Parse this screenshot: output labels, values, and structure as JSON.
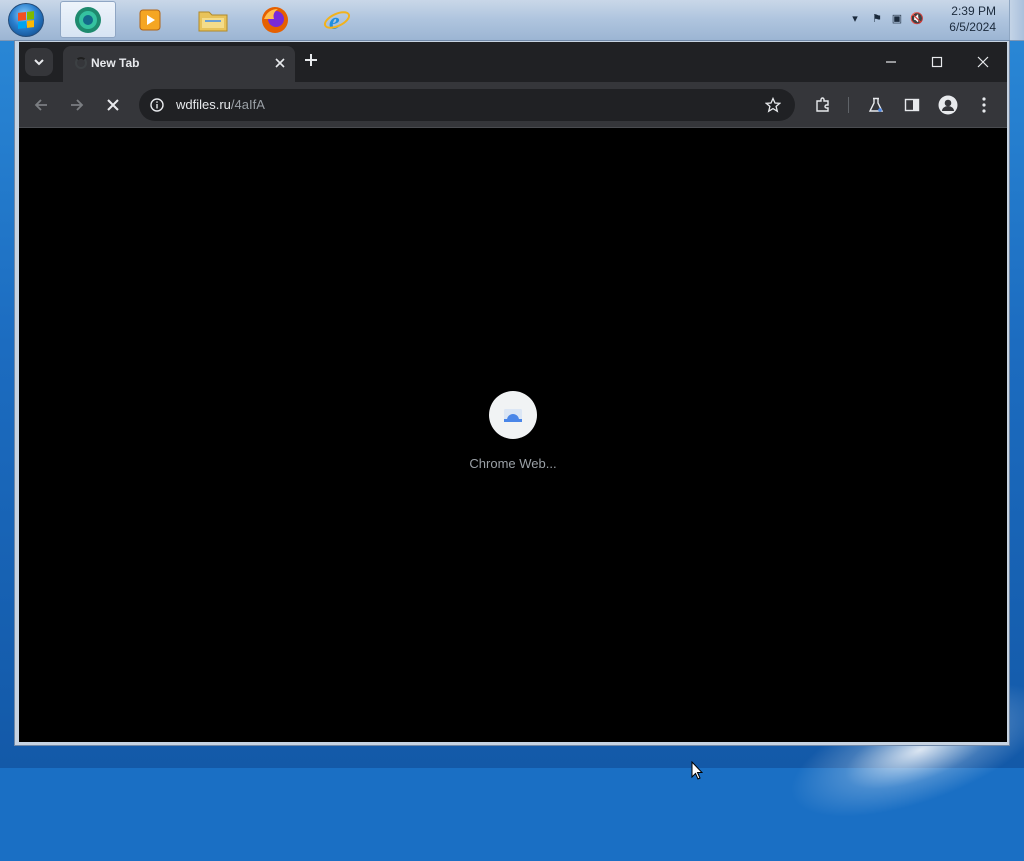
{
  "taskbar": {
    "clock": {
      "time": "2:39 PM",
      "date": "6/5/2024"
    },
    "pinned": [
      "start-button",
      "chrome",
      "media-player",
      "file-explorer",
      "firefox",
      "internet-explorer"
    ]
  },
  "browser": {
    "tab": {
      "title": "New Tab"
    },
    "address": {
      "host": "wdfiles.ru",
      "path": "/4aIfA"
    },
    "content": {
      "loading_label": "Chrome Web..."
    }
  },
  "colors": {
    "chrome_dark": "#202124",
    "toolbar": "#35363a",
    "page_bg": "#000000",
    "accent_blue": "#4a86e8"
  }
}
